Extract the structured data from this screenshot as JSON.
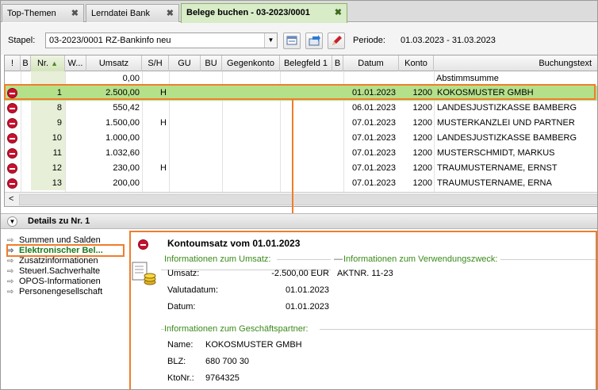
{
  "tabs": [
    {
      "label": "Top-Themen",
      "active": false
    },
    {
      "label": "Lerndatei Bank",
      "active": false
    },
    {
      "label": "Belege buchen  - 03-2023/0001",
      "active": true
    }
  ],
  "tab_close": "✖",
  "stapel": {
    "label": "Stapel:",
    "value": "03-2023/0001   RZ-Bankinfo neu",
    "periode_label": "Periode:",
    "periode_value": "01.03.2023 - 31.03.2023"
  },
  "grid": {
    "headers": [
      "!",
      "B",
      "Nr.",
      "W...",
      "Umsatz",
      "S/H",
      "GU",
      "BU",
      "Gegenkonto",
      "Belegfeld 1",
      "B",
      "Datum",
      "Konto",
      "Buchungstext"
    ],
    "summary_row": {
      "umsatz": "0,00",
      "text": "Abstimmsumme"
    },
    "rows": [
      {
        "nr": "1",
        "umsatz": "2.500,00",
        "sh": "H",
        "datum": "01.01.2023",
        "konto": "1200",
        "text": "KOKOSMUSTER GMBH"
      },
      {
        "nr": "8",
        "umsatz": "550,42",
        "sh": "",
        "datum": "06.01.2023",
        "konto": "1200",
        "text": "LANDESJUSTIZKASSE BAMBERG"
      },
      {
        "nr": "9",
        "umsatz": "1.500,00",
        "sh": "H",
        "datum": "07.01.2023",
        "konto": "1200",
        "text": "MUSTERKANZLEI UND PARTNER"
      },
      {
        "nr": "10",
        "umsatz": "1.000,00",
        "sh": "",
        "datum": "07.01.2023",
        "konto": "1200",
        "text": "LANDESJUSTIZKASSE BAMBERG"
      },
      {
        "nr": "11",
        "umsatz": "1.032,60",
        "sh": "",
        "datum": "07.01.2023",
        "konto": "1200",
        "text": "MUSTERSCHMIDT, MARKUS"
      },
      {
        "nr": "12",
        "umsatz": "230,00",
        "sh": "H",
        "datum": "07.01.2023",
        "konto": "1200",
        "text": "TRAUMUSTERNAME, ERNST"
      },
      {
        "nr": "13",
        "umsatz": "200,00",
        "sh": "",
        "datum": "07.01.2023",
        "konto": "1200",
        "text": "TRAUMUSTERNAME, ERNA"
      }
    ],
    "scroll_left": "<"
  },
  "details": {
    "title": "Details zu Nr. 1",
    "nav": [
      "Summen und Salden",
      "Elektronischer Bel...",
      "Zusatzinformationen",
      "Steuerl.Sachverhalte",
      "OPOS-Informationen",
      "Personengesellschaft"
    ]
  },
  "panel": {
    "title": "Kontoumsatz vom 01.01.2023",
    "umsatz_group": "Informationen zum Umsatz:",
    "verwendung_group": "Informationen zum Verwendungszweck:",
    "umsatz_label": "Umsatz:",
    "umsatz_value": "-2.500,00 EUR",
    "valuta_label": "Valutadatum:",
    "valuta_value": "01.01.2023",
    "datum_label": "Datum:",
    "datum_value": "01.01.2023",
    "verwendung_value": "AKTNR. 11-23",
    "partner_group": "Informationen zum Geschäftspartner:",
    "name_label": "Name:",
    "name_value": "KOKOSMUSTER GMBH",
    "blz_label": "BLZ:",
    "blz_value": "680 700 30",
    "kto_label": "KtoNr.:",
    "kto_value": "9764325"
  },
  "colors": {
    "accent_orange": "#f07d2c",
    "selected_row": "#b5e08a",
    "group_green": "#3a8a1a",
    "stop_red": "#c8102e"
  }
}
